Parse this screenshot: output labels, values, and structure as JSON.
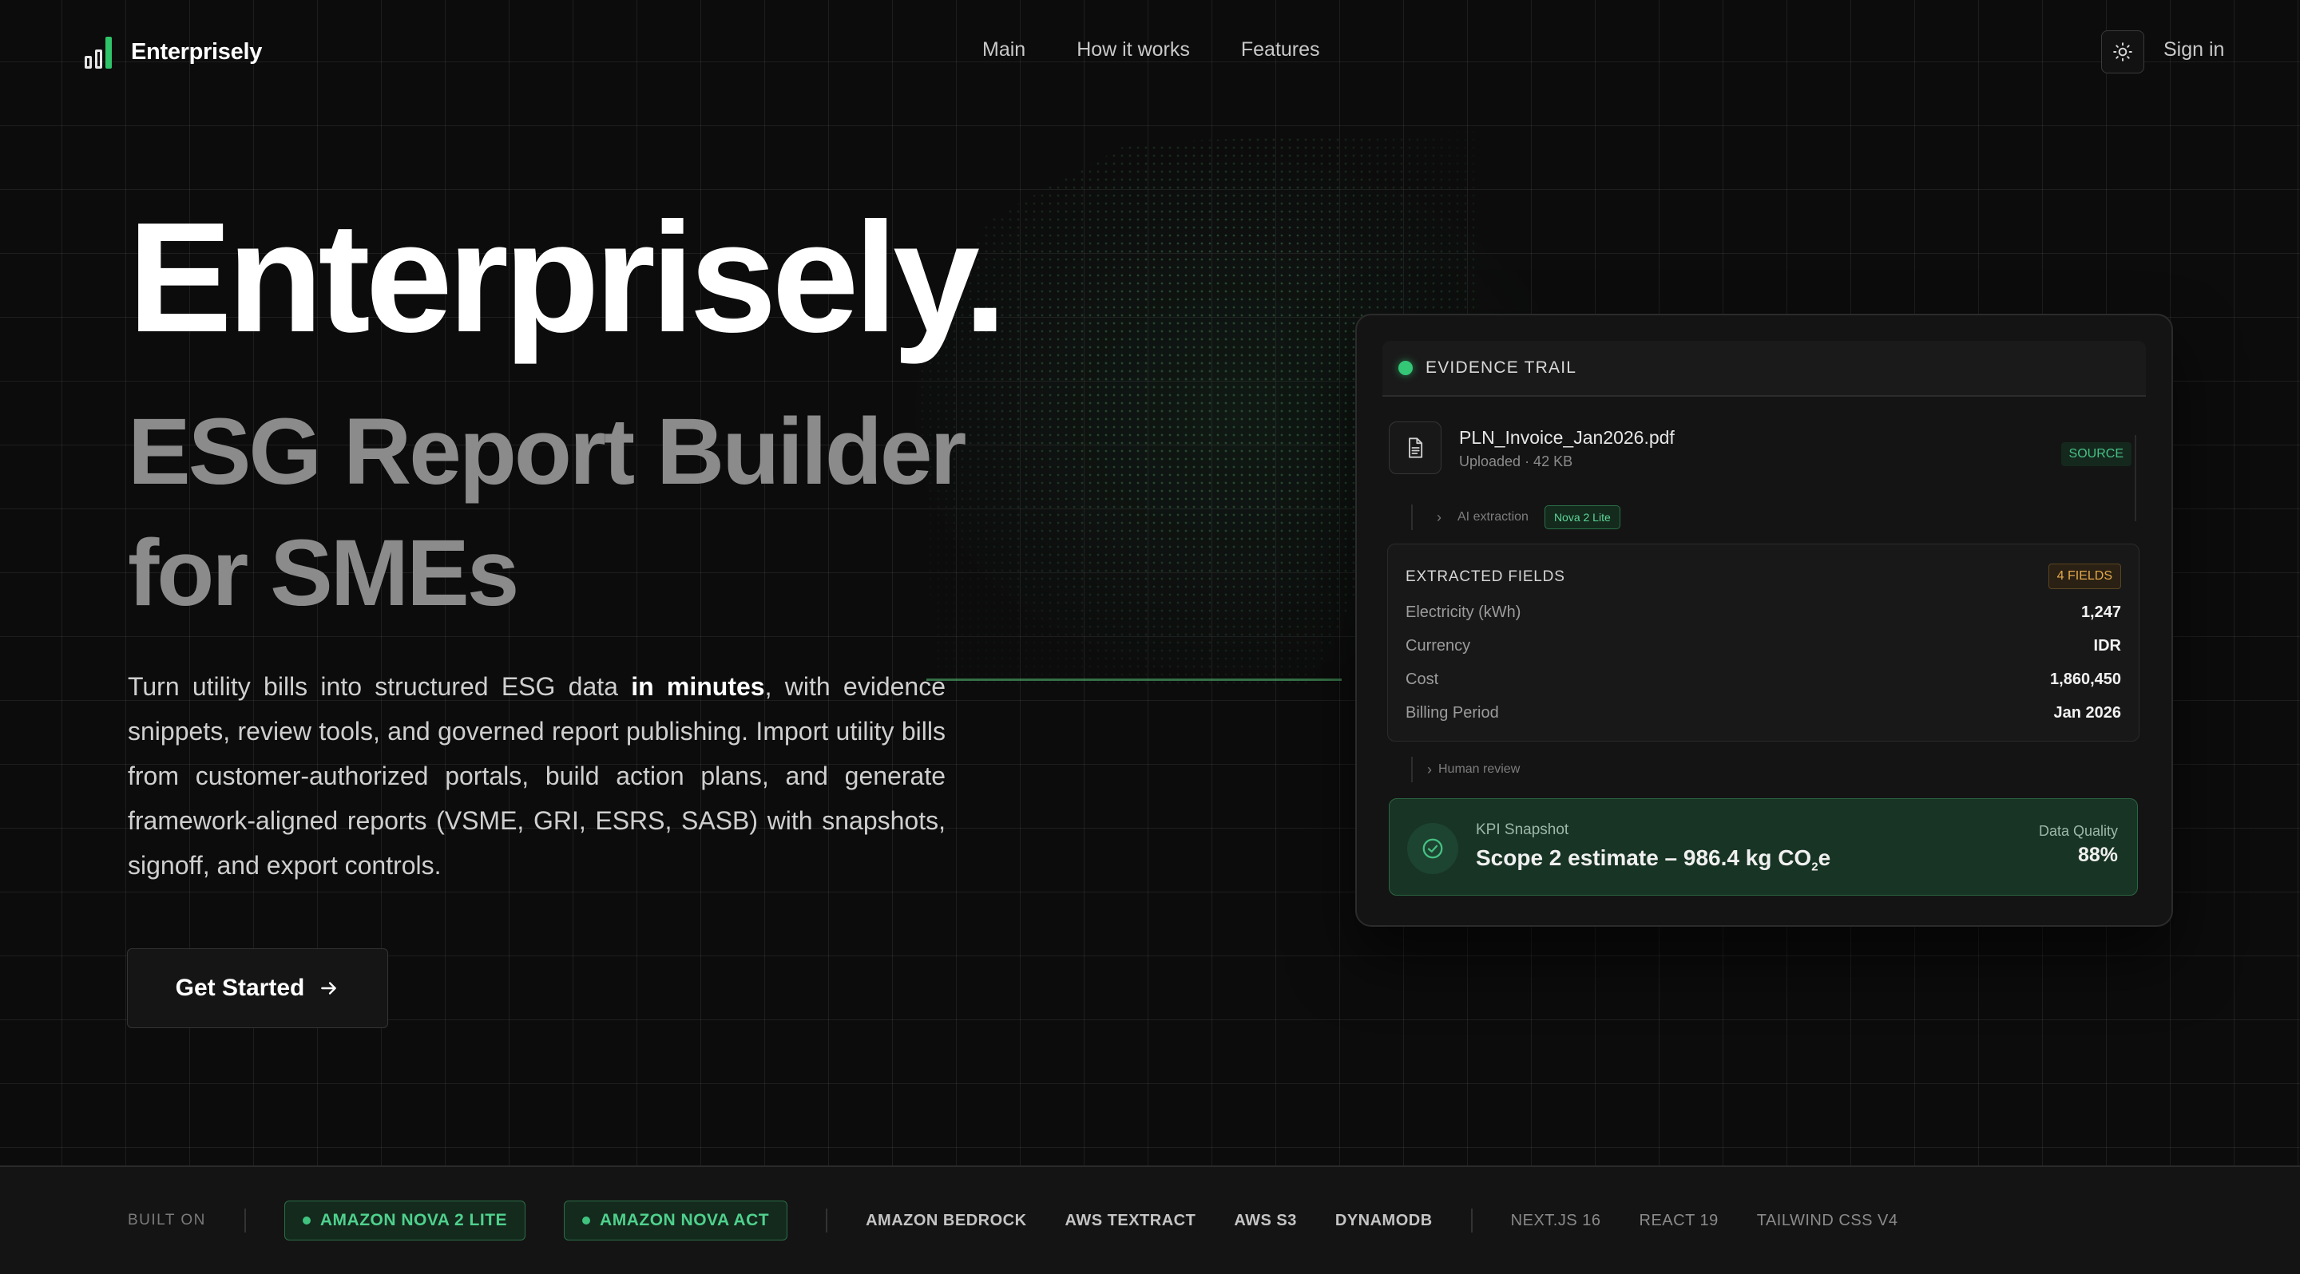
{
  "nav": {
    "brand": "Enterprisely",
    "links": [
      {
        "label": "Main"
      },
      {
        "label": "How it works"
      },
      {
        "label": "Features"
      }
    ],
    "theme_icon": "sun-icon",
    "signin_label": "Sign in"
  },
  "hero": {
    "title": "Enterprisely.",
    "subtitle_line1": "ESG Report Builder",
    "subtitle_line2": "for SMEs",
    "desc_before": "Turn utility bills into structured ESG data ",
    "desc_emph": "in minutes",
    "desc_after": ", with evidence snippets, review tools, and governed report publishing. Import utility bills from customer-authorized portals, build action plans, and generate framework-aligned reports (VSME, GRI, ESRS, SASB) with snapshots, signoff, and export controls.",
    "cta_label": "Get Started",
    "cta_icon": "arrow-right-icon"
  },
  "evidence": {
    "header": "EVIDENCE TRAIL",
    "file": {
      "name": "PLN_Invoice_Jan2026.pdf",
      "meta": "Uploaded · 42 KB",
      "badge": "SOURCE",
      "icon": "document-icon"
    },
    "ai_step": {
      "label": "AI extraction",
      "badge": "Nova 2 Lite"
    },
    "fields": {
      "title": "EXTRACTED FIELDS",
      "badge": "4 FIELDS",
      "rows": [
        {
          "label": "Electricity (kWh)",
          "value": "1,247"
        },
        {
          "label": "Currency",
          "value": "IDR"
        },
        {
          "label": "Cost",
          "value": "1,860,450"
        },
        {
          "label": "Billing Period",
          "value": "Jan 2026"
        }
      ]
    },
    "review_step": {
      "label": "Human review"
    },
    "kpi": {
      "label": "KPI Snapshot",
      "value_main": "Scope 2 estimate – 986.4 kg CO",
      "value_sub": "2",
      "value_tail": "e",
      "quality_label": "Data Quality",
      "quality_value": "88%",
      "icon": "check-circle-icon"
    }
  },
  "strip": {
    "built_on": "BUILT ON",
    "highlighted": [
      "AMAZON NOVA 2 LITE",
      "AMAZON NOVA ACT"
    ],
    "aws": [
      "AMAZON BEDROCK",
      "AWS TEXTRACT",
      "AWS S3",
      "DYNAMODB"
    ],
    "frontend": [
      "NEXT.JS 16",
      "REACT 19",
      "TAILWIND CSS V4"
    ]
  },
  "colors": {
    "accent_green": "#34c776",
    "background": "#0c0c0c",
    "warning_amber": "#e4a84a"
  }
}
